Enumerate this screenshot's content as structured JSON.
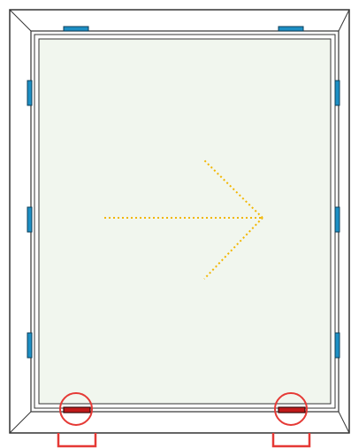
{
  "diagram": {
    "kind": "window-frame-hardware-layout",
    "opening_direction": "right",
    "colors": {
      "background": "#ffffff",
      "frame_stroke": "#333333",
      "frame_fill": "#ffffff",
      "glass": "#f1f6ee",
      "hinge_fill": "#1d8fc4",
      "hinge_stroke": "#0d3d57",
      "lock_fill": "#c01a1a",
      "lock_stroke": "#3a0b0b",
      "highlight_red": "#e53935",
      "arrow_gold": "#f2b600"
    },
    "hardware": {
      "top_hinges": 2,
      "left_hinges": 3,
      "right_hinges": 3,
      "bottom_locks_highlighted": 2
    }
  }
}
